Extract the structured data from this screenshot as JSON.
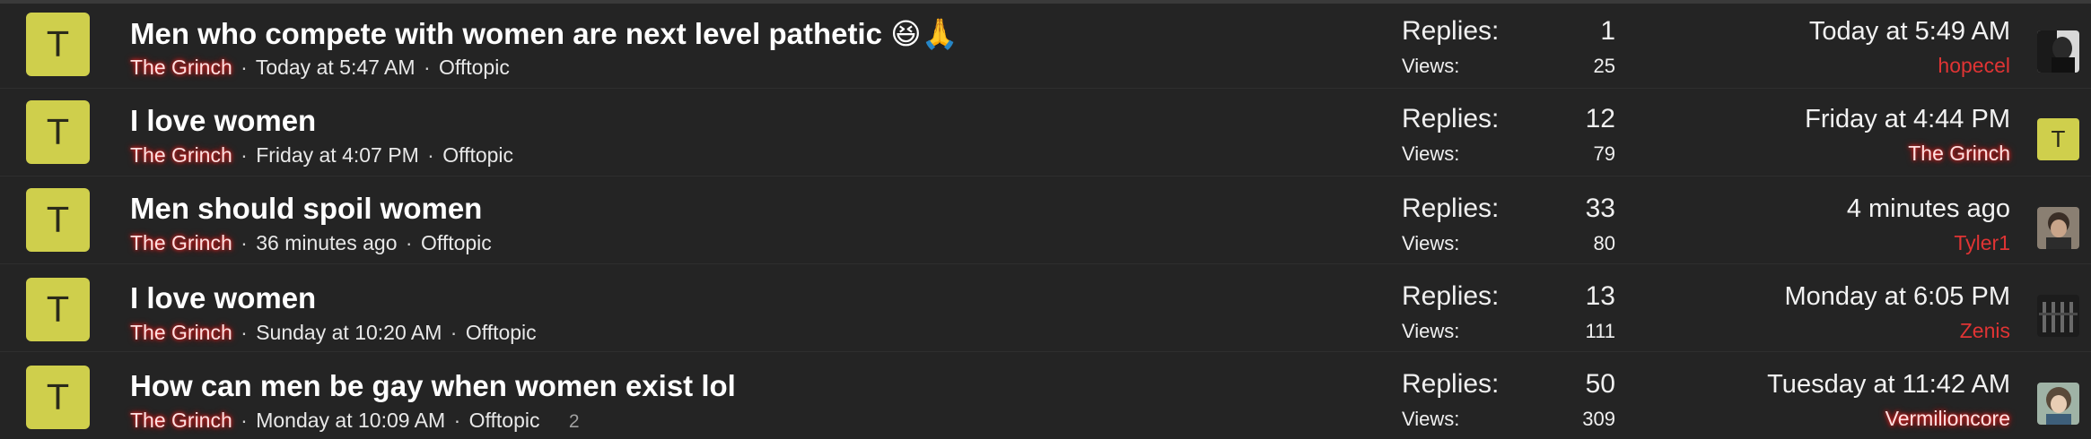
{
  "threads": [
    {
      "avatar_letter": "T",
      "title": "Men who compete with women are next level pathetic 😆🙏",
      "author": "The Grinch",
      "started": "Today at 5:47 AM",
      "forum": "Offtopic",
      "pages": "",
      "replies_label": "Replies:",
      "replies": "1",
      "views_label": "Views:",
      "views": "25",
      "last_time": "Today at 5:49 AM",
      "last_user": "hopecel",
      "last_avatar": "photo-dark-portrait"
    },
    {
      "avatar_letter": "T",
      "title": "I love women",
      "author": "The Grinch",
      "started": "Friday at 4:07 PM",
      "forum": "Offtopic",
      "pages": "",
      "replies_label": "Replies:",
      "replies": "12",
      "views_label": "Views:",
      "views": "79",
      "last_time": "Friday at 4:44 PM",
      "last_user": "The Grinch",
      "last_avatar_letter": "T"
    },
    {
      "avatar_letter": "T",
      "title": "Men should spoil women",
      "author": "The Grinch",
      "started": "36 minutes ago",
      "forum": "Offtopic",
      "pages": "",
      "replies_label": "Replies:",
      "replies": "33",
      "views_label": "Views:",
      "views": "80",
      "last_time": "4 minutes ago",
      "last_user": "Tyler1",
      "last_avatar": "photo-man-portrait"
    },
    {
      "avatar_letter": "T",
      "title": "I love women",
      "author": "The Grinch",
      "started": "Sunday at 10:20 AM",
      "forum": "Offtopic",
      "pages": "",
      "replies_label": "Replies:",
      "replies": "13",
      "views_label": "Views:",
      "views": "111",
      "last_time": "Monday at 6:05 PM",
      "last_user": "Zenis",
      "last_avatar": "photo-dark-bars"
    },
    {
      "avatar_letter": "T",
      "title": "How can men be gay when women exist lol",
      "author": "The Grinch",
      "started": "Monday at 10:09 AM",
      "forum": "Offtopic",
      "pages": "2",
      "replies_label": "Replies:",
      "replies": "50",
      "views_label": "Views:",
      "views": "309",
      "last_time": "Tuesday at 11:42 AM",
      "last_user": "Vermilioncore",
      "last_avatar": "photo-anime-portrait"
    }
  ],
  "meta_separator": "·",
  "colors": {
    "background": "#242424",
    "avatar_bg": "#cfcf4c",
    "user_red": "#e03434",
    "glow_red": "#ff2d2d"
  }
}
